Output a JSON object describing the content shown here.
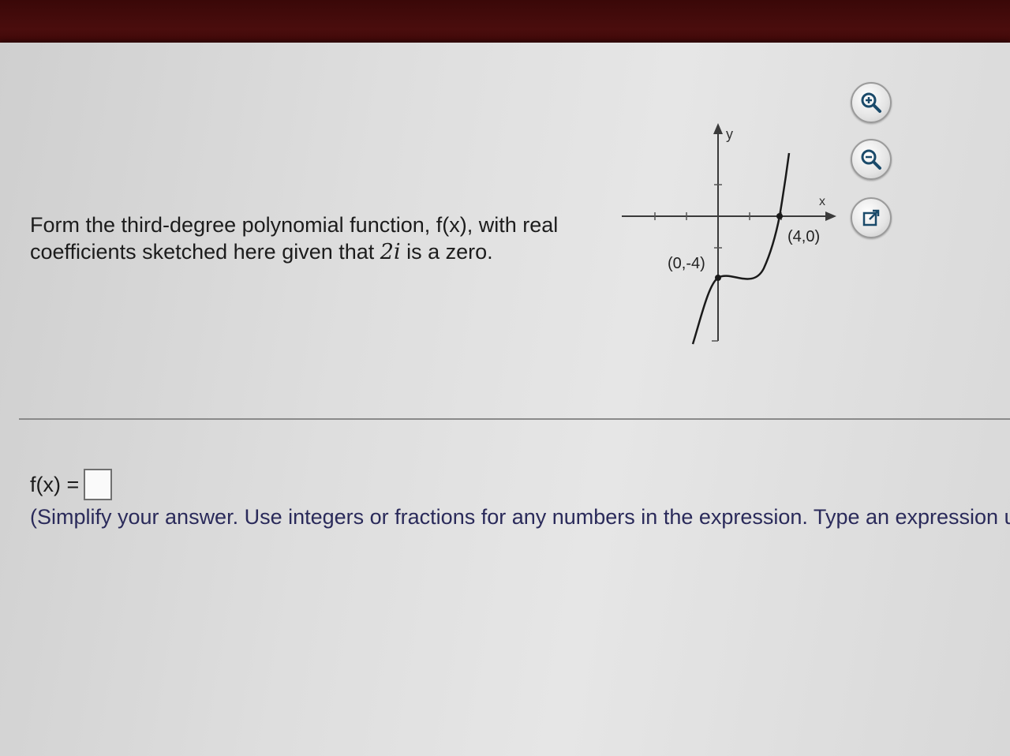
{
  "header": {
    "title": ""
  },
  "question": {
    "text_before": "Form the third-degree polynomial function, f(x), with real coefficients sketched here given that ",
    "zero": "2i",
    "text_after": " is a zero."
  },
  "graph": {
    "y_label": "y",
    "x_label": "x",
    "point_1": "(4,0)",
    "point_2": "(0,-4)"
  },
  "toolbar": {
    "zoom_in": "zoom-in-icon",
    "zoom_out": "zoom-out-icon",
    "popout": "external-link-icon"
  },
  "answer": {
    "label": "f(x) =",
    "value": "",
    "hint": "(Simplify your answer. Use integers or fractions for any numbers in the expression. Type an expression u"
  }
}
